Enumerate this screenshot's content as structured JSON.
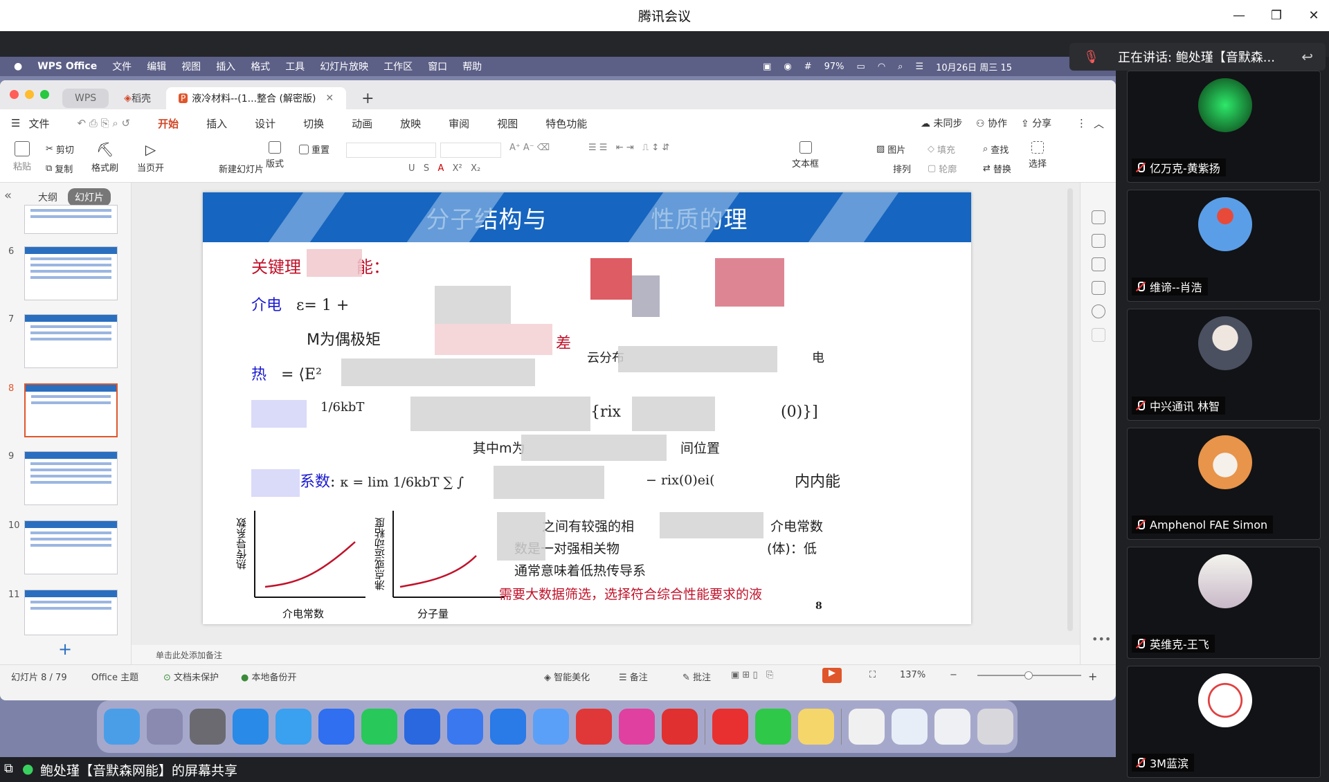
{
  "window": {
    "title": "腾讯会议",
    "controls": [
      "minimize",
      "restore",
      "close"
    ]
  },
  "speaking": {
    "label": "正在讲话: 鲍处瑾【音默森..."
  },
  "share_bar": {
    "label": "鲍处瑾【音默森网能】的屏幕共享"
  },
  "mac_menu": {
    "app": "WPS Office",
    "items": [
      "文件",
      "编辑",
      "视图",
      "插入",
      "格式",
      "工具",
      "幻灯片放映",
      "工作区",
      "窗口",
      "帮助"
    ],
    "battery": "97%",
    "datetime": "10月26日 周三 15"
  },
  "wps": {
    "tabs": [
      "WPS",
      "稻壳",
      "液冷材料--(1...整合 (解密版)"
    ],
    "menu": [
      "文件",
      "开始",
      "插入",
      "设计",
      "切换",
      "动画",
      "放映",
      "审阅",
      "视图",
      "特色功能"
    ],
    "menu_right": [
      "未同步",
      "协作",
      "分享"
    ],
    "toolbar": {
      "paste": "粘贴",
      "cut": "剪切",
      "copy": "复制",
      "format_painter": "格式刷",
      "from_current": "当页开",
      "new_slide": "新建幻灯片",
      "layout": "版式",
      "reset": "重置",
      "textbox": "文本框",
      "picture": "图片",
      "fill": "填充",
      "arrange": "排列",
      "outline": "轮廓",
      "find": "查找",
      "replace": "替换",
      "select": "选择"
    },
    "left_tabs": [
      "大纲",
      "幻灯片"
    ],
    "thumbs": [
      "6",
      "7",
      "8",
      "9",
      "10",
      "11"
    ],
    "notes_placeholder": "单击此处添加备注",
    "status": {
      "slide": "幻灯片 8 / 79",
      "theme": "Office 主题",
      "protect": "文档未保护",
      "backup": "本地备份开",
      "beautify": "智能美化",
      "notes": "备注",
      "comment": "批注",
      "zoom": "137%"
    }
  },
  "slide": {
    "title_left": "分子结构与",
    "title_right": "性质的理",
    "section": "关键理",
    "section_tail": "能：",
    "lbl_dielectric": "介电",
    "lbl_dielectric_formula": "ε",
    "lbl_dielectric_eq": "= 1 +",
    "m_dipole": "M为偶极矩",
    "m_tail": "差",
    "lbl_heat": "热",
    "heat_eq": "= ⟨E²",
    "cluster_text": "云分布",
    "electron": "电",
    "eq_frac": "1/6kbT",
    "eq_r": "{rix",
    "eq_tail": "(0)}]",
    "m_is": "其中m为",
    "position": "间位置",
    "conduct_label": "系数",
    "conduct_eq": "κ = lim  1/6kbT ∑ ∫",
    "conduct_mid": "− rix(0)ei(",
    "internal_energy": "内内能",
    "right_1": "之间有较强的相",
    "right_1b": "介电常数",
    "right_2": "数是一对强相关物",
    "right_2b": "(体)：低",
    "right_3": "通常意味着低热传导系",
    "conclusion": "需要大数据筛选，选择符合综合性能要求的液",
    "plot1_y": "热传导系数",
    "plot1_x": "介电常数",
    "plot2_y": "沸点或运动粘度",
    "plot2_x": "分子量",
    "page_num": "8"
  },
  "participants": [
    {
      "name": "亿万克-黄紫扬",
      "avatar": "circuit-avatar"
    },
    {
      "name": "维谛--肖浩",
      "avatar": "balloon-avatar"
    },
    {
      "name": "中兴通讯 林智",
      "avatar": "anime-avatar"
    },
    {
      "name": "Amphenol FAE Simon",
      "avatar": "cat-avatar"
    },
    {
      "name": "英维克-王飞",
      "avatar": "calligraphy-avatar"
    },
    {
      "name": "3M蓝滨",
      "avatar": "dragon-avatar"
    }
  ]
}
